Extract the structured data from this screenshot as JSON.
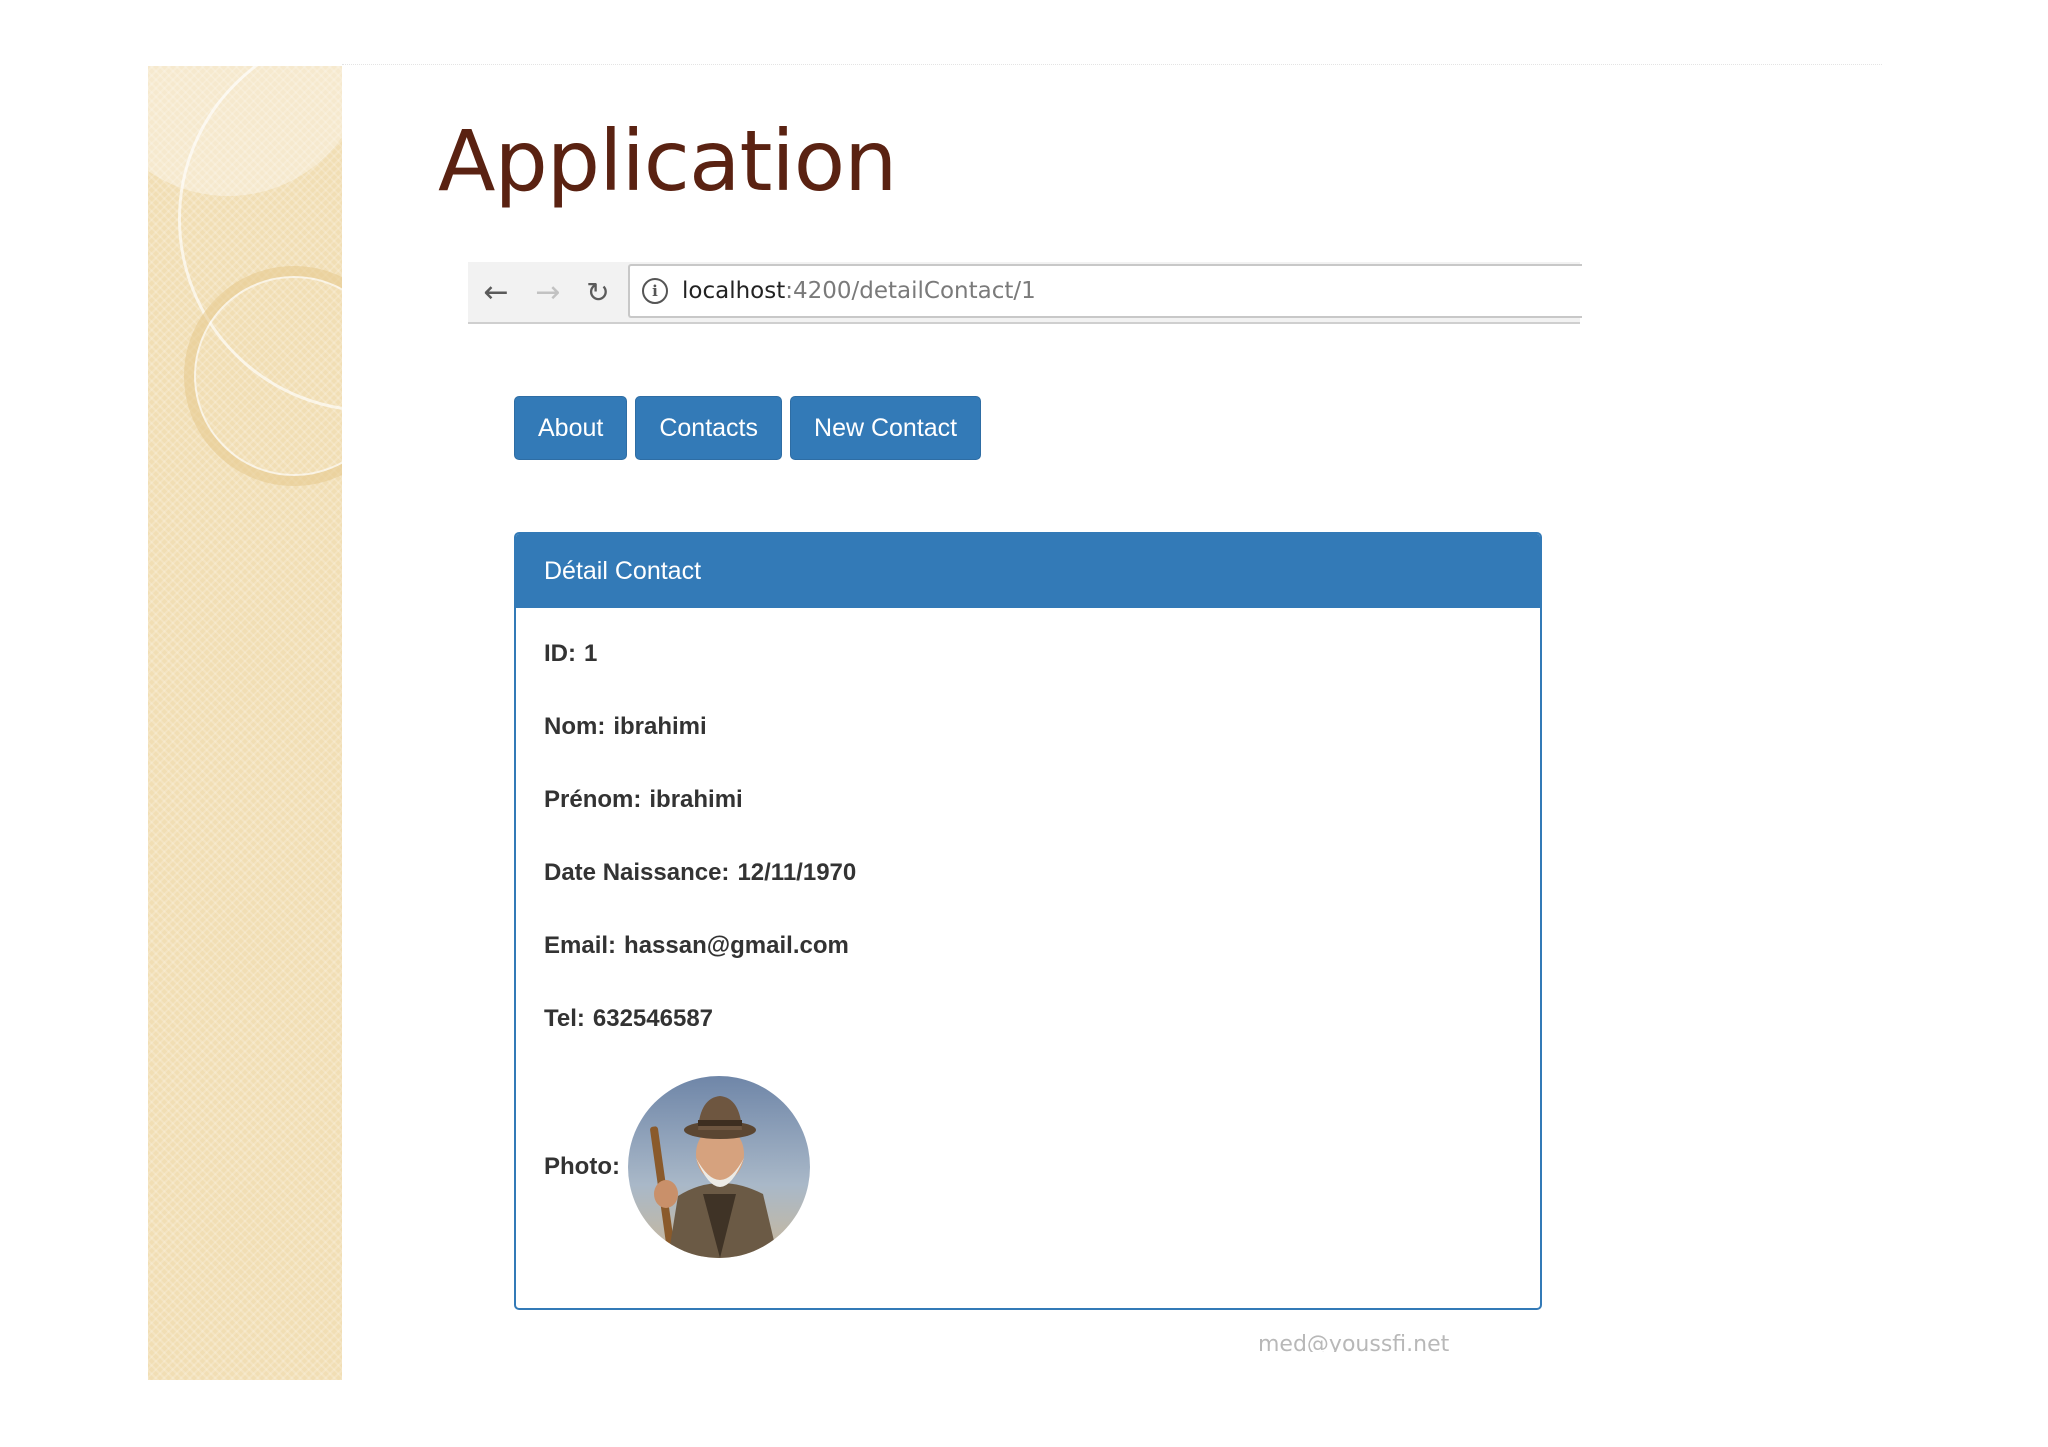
{
  "slide": {
    "title": "Application",
    "footer": "med@youssfi.net"
  },
  "browser": {
    "url_host": "localhost",
    "url_rest": ":4200/detailContact/1",
    "back_icon": "arrow-left-icon",
    "forward_icon": "arrow-right-icon",
    "reload_icon": "reload-icon",
    "info_icon": "info-icon"
  },
  "nav": {
    "about": "About",
    "contacts": "Contacts",
    "new_contact": "New Contact"
  },
  "panel": {
    "heading": "Détail Contact",
    "fields": [
      {
        "label": "ID:",
        "value": "1"
      },
      {
        "label": "Nom:",
        "value": "ibrahimi"
      },
      {
        "label": "Prénom:",
        "value": "ibrahimi"
      },
      {
        "label": "Date Naissance:",
        "value": "12/11/1970"
      },
      {
        "label": "Email:",
        "value": "hassan@gmail.com"
      },
      {
        "label": "Tel:",
        "value": "632546587"
      }
    ],
    "photo_label": "Photo:"
  },
  "colors": {
    "primary": "#337ab7",
    "title": "#5a2212",
    "strip": "#f1deb4"
  }
}
